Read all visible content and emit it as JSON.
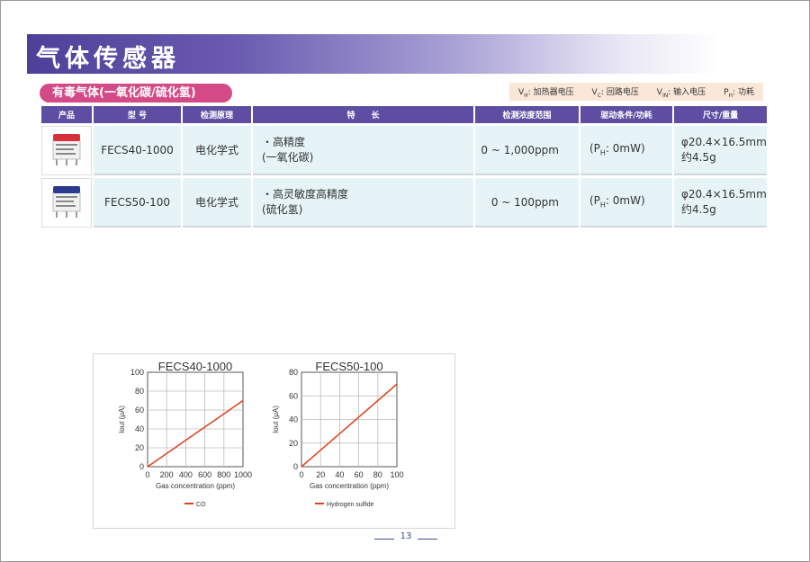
{
  "page_title": "气体传感器",
  "section_title": "有毒气体(一氧化碳/硫化氢)",
  "legend": [
    {
      "sym": "V",
      "sub": "H",
      "text": ": 加热器电压"
    },
    {
      "sym": "V",
      "sub": "C",
      "text": ": 回路电压"
    },
    {
      "sym": "V",
      "sub": "IN",
      "text": ": 输入电压"
    },
    {
      "sym": "P",
      "sub": "H",
      "text": ": 功耗"
    }
  ],
  "table": {
    "headers": [
      "产品",
      "型 号",
      "检测原理",
      "特　　长",
      "检测浓度范围",
      "驱动条件/功耗",
      "尺寸/重量"
    ],
    "rows": [
      {
        "model": "FECS40-1000",
        "principle": "电化学式",
        "feature1": "・高精度",
        "feature2": "(一氧化碳)",
        "range": "0 ~ 1,000ppm",
        "drive_pre": "(P",
        "drive_sub": "H",
        "drive_post": ": 0mW)",
        "size1": "φ20.4×16.5mm",
        "size2": "约4.5g",
        "sensor_color": "#d8303a"
      },
      {
        "model": "FECS50-100",
        "principle": "电化学式",
        "feature1": "・高灵敏度高精度",
        "feature2": "(硫化氢)",
        "range": "0 ~ 100ppm",
        "drive_pre": "(P",
        "drive_sub": "H",
        "drive_post": ": 0mW)",
        "size1": "φ20.4×16.5mm",
        "size2": "约4.5g",
        "sensor_color": "#2b3a8f"
      }
    ]
  },
  "chart_data": [
    {
      "type": "line",
      "title": "FECS40-1000",
      "xlabel": "Gas concentration (ppm)",
      "ylabel": "Iout (μA)",
      "xlim": [
        0,
        1000
      ],
      "ylim": [
        0,
        100
      ],
      "xticks": [
        0,
        200,
        400,
        600,
        800,
        1000
      ],
      "yticks": [
        0,
        20,
        40,
        60,
        80,
        100
      ],
      "grid": true,
      "legend_position": "bottom",
      "series": [
        {
          "name": "CO",
          "color": "#e0401e",
          "x": [
            0,
            1000
          ],
          "y": [
            0,
            70
          ]
        }
      ]
    },
    {
      "type": "line",
      "title": "FECS50-100",
      "xlabel": "Gas concentration (ppm)",
      "ylabel": "Iout (μA)",
      "xlim": [
        0,
        100
      ],
      "ylim": [
        0,
        80
      ],
      "xticks": [
        0,
        20,
        40,
        60,
        80,
        100
      ],
      "yticks": [
        0,
        20,
        40,
        60,
        80
      ],
      "grid": true,
      "legend_position": "bottom",
      "series": [
        {
          "name": "Hydrogen sulfide",
          "color": "#e0401e",
          "x": [
            0,
            100
          ],
          "y": [
            0,
            70
          ]
        }
      ]
    }
  ],
  "page_number": "13"
}
